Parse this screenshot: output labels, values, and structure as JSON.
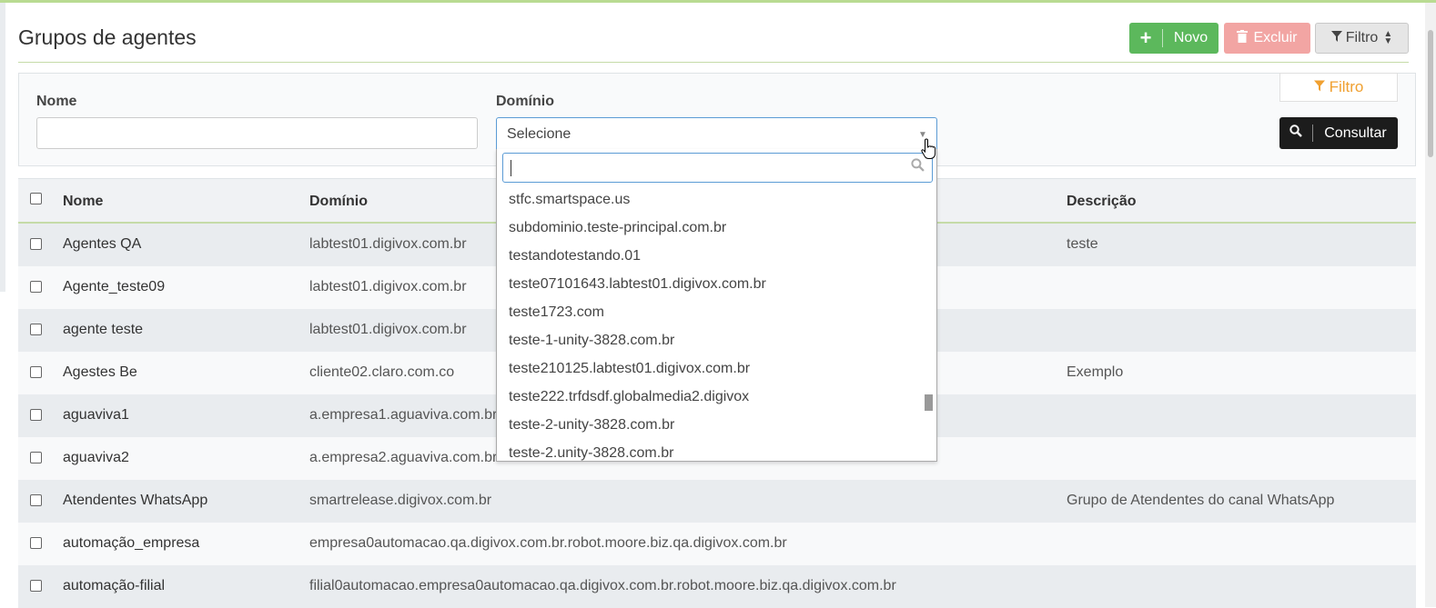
{
  "header": {
    "title": "Grupos de agentes",
    "new_label": "Novo",
    "delete_label": "Excluir",
    "filter_label": "Filtro"
  },
  "filter": {
    "tab_label": "Filtro",
    "name_label": "Nome",
    "domain_label": "Domínio",
    "domain_selected": "Selecione",
    "consult_label": "Consultar",
    "domain_options": [
      "stfc.smartspace.us",
      "subdominio.teste-principal.com.br",
      "testandotestando.01",
      "teste07101643.labtest01.digivox.com.br",
      "teste1723.com",
      "teste-1-unity-3828.com.br",
      "teste210125.labtest01.digivox.com.br",
      "teste222.trfdsdf.globalmedia2.digivox",
      "teste-2-unity-3828.com.br",
      "teste-2.unity-3828.com.br"
    ]
  },
  "table": {
    "columns": [
      "Nome",
      "Domínio",
      "Descrição"
    ],
    "rows": [
      {
        "name": "Agentes QA",
        "domain": "labtest01.digivox.com.br",
        "description": "teste"
      },
      {
        "name": "Agente_teste09",
        "domain": "labtest01.digivox.com.br",
        "description": ""
      },
      {
        "name": "agente teste",
        "domain": "labtest01.digivox.com.br",
        "description": ""
      },
      {
        "name": "Agestes Be",
        "domain": "cliente02.claro.com.co",
        "description": "Exemplo"
      },
      {
        "name": "aguaviva1",
        "domain": "a.empresa1.aguaviva.com.br",
        "description": ""
      },
      {
        "name": "aguaviva2",
        "domain": "a.empresa2.aguaviva.com.br",
        "description": ""
      },
      {
        "name": "Atendentes WhatsApp",
        "domain": "smartrelease.digivox.com.br",
        "description": "Grupo de Atendentes do canal WhatsApp"
      },
      {
        "name": "automação_empresa",
        "domain": "empresa0automacao.qa.digivox.com.br.robot.moore.biz.qa.digivox.com.br",
        "description": ""
      },
      {
        "name": "automação-filial",
        "domain": "filial0automacao.empresa0automacao.qa.digivox.com.br.robot.moore.biz.qa.digivox.com.br",
        "description": ""
      }
    ]
  },
  "colors": {
    "accent_green": "#5cb85c",
    "delete_red": "#f2a5a3",
    "filter_orange": "#f0a030"
  }
}
